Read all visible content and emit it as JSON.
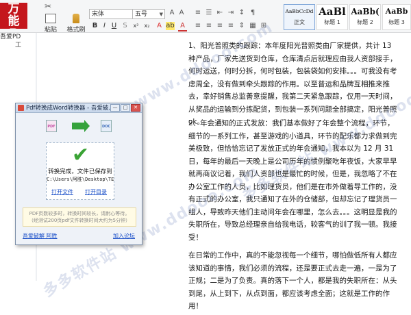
{
  "app": {
    "logo_text": "万能PDF",
    "name_line1": "吾爱PD",
    "name_line2": "工"
  },
  "ribbon": {
    "paste_label": "粘贴",
    "format_painter_label": "格式刷",
    "cut_label": "✂",
    "font_name": "宋体",
    "font_size": "五号",
    "styles": [
      {
        "sample": "AaBbCcDd",
        "label": "正文"
      },
      {
        "sample": "AaBl",
        "label": "标题 1"
      },
      {
        "sample": "AaBb(",
        "label": "标题 2"
      },
      {
        "sample": "AaBb",
        "label": "标题 3"
      }
    ]
  },
  "document": {
    "paragraphs": [
      "1、阳光普照类的跟踪：本年度阳光普照类由厂家提供，共计 13 种产品，厂家先送货到仓库，仓库清点后就理应由我人资部接手，何时运送，何时分拆，何时包装，包装袋如何安排。。。可我没有考虑周全，没有做到牵头跟踪的作用。以至普运和品牌互相推来推去，幸好销售总监善意提醒，我第二天紧急跟踪，仅用一天时间，从奖品的运输到分拣配货，到包装一系列问题全部搞定，阳光普照 ok。",
      "2、年会通知的正式发放：我们基本做好了年会整个流程，环节，细节的一系列工作，甚至游戏的小道具，环节的配乐都力求做到完美极致，但恰恰忘记了发放正式的年会通知，我本以为 12 月 31 日，每年的最后一天晚上是公司历年的惯例聚吃年夜饭，大家早早就再商议记着，我们人资部也是最忙的时候，但是，我忽略了不在办公室工作的人员，比如理货员，他们是在市外做着导工作的，没有正式的办公室，我只通知了在外的仓储部，但却忘记了理货员一组人，导致昨天他们主动问年会在哪里，怎么去。。。这明显是我的失职所在，导致总经理亲自给我电话，较客气的训了我一顿。我接受！",
      "在日常的工作中，真的不能忽视每一个细节，哪怕做低所有人都应该知道的事情，我们必须的流程，还是要正式去走一遍，一是为了正规；二是为了负责。真的落下一个人，都是我的失职所在：从头到尾，从上到下，从点到面，都应该考虑全面；这就是工作的作用！"
    ],
    "watermark": "多多软件站  www.ddooo.com"
  },
  "dialog": {
    "title": "Pdf转换成Word转换器 - 吾爱破...",
    "btn_min": "—",
    "btn_max": "□",
    "btn_close": "✕",
    "pdf_icon_label": "PDF",
    "doc_icon_label": "DOC",
    "status_done": "转换完成，文件已保存到",
    "save_path": "C:\\Users\\阿胜\\Desktop\\TEST\\",
    "open_file": "打开文件",
    "open_folder": "打开目录",
    "notice": "PDF页数较多时，转换时间较长，请耐心等待。（经测试200页pdf文件转换时间大约为5分钟）",
    "footer_left": "吾爱破解 阿胜",
    "footer_right": "加入论坛"
  }
}
